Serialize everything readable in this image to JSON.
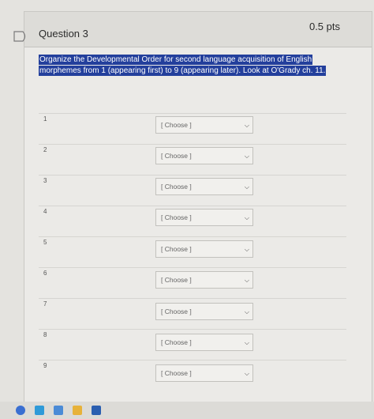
{
  "question": {
    "title": "Question 3",
    "points": "0.5 pts",
    "prompt": "Organize the Developmental Order for second language acquisition of English morphemes from 1 (appearing first) to 9 (appearing later). Look at O'Grady ch. 11."
  },
  "rows": [
    {
      "number": "1",
      "select": "[ Choose ]"
    },
    {
      "number": "2",
      "select": "[ Choose ]"
    },
    {
      "number": "3",
      "select": "[ Choose ]"
    },
    {
      "number": "4",
      "select": "[ Choose ]"
    },
    {
      "number": "5",
      "select": "[ Choose ]"
    },
    {
      "number": "6",
      "select": "[ Choose ]"
    },
    {
      "number": "7",
      "select": "[ Choose ]"
    },
    {
      "number": "8",
      "select": "[ Choose ]"
    },
    {
      "number": "9",
      "select": "[ Choose ]"
    }
  ],
  "icons": {
    "flag": "flag-icon",
    "dropdown": "chevron-down-icon"
  },
  "colors": {
    "highlight": "#233f9c"
  }
}
